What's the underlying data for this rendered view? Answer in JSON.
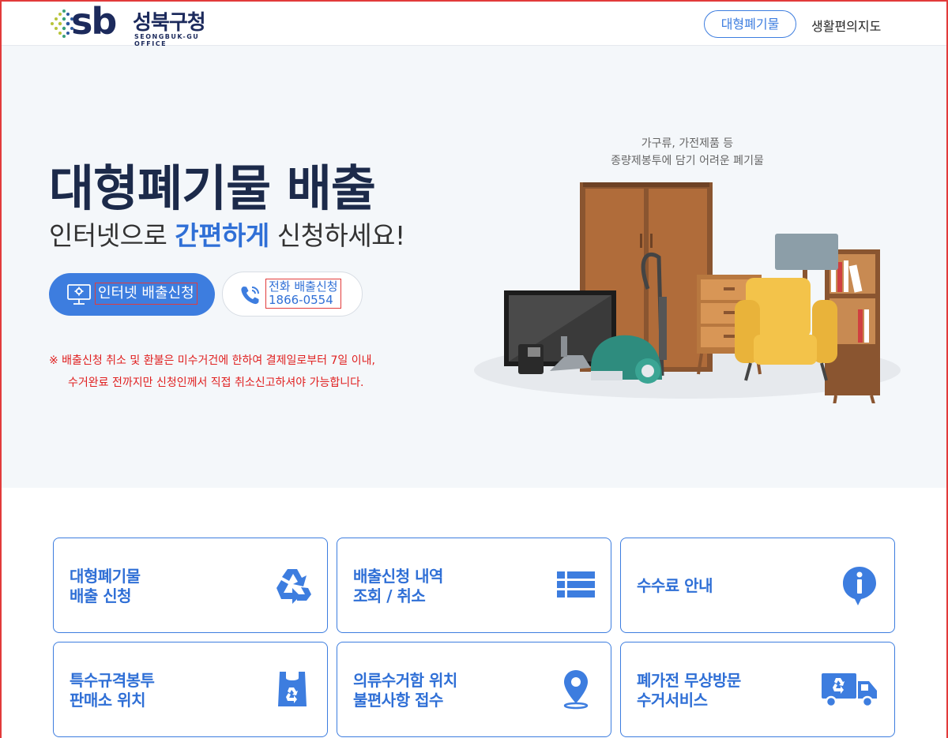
{
  "header": {
    "logo_sb": "sb",
    "logo_name": "성북구청",
    "logo_sub": "SEONGBUK-GU OFFICE",
    "nav_primary": "대형폐기물",
    "nav_secondary": "생활편의지도"
  },
  "hero": {
    "title": "대형폐기물 배출",
    "subtitle_before": "인터넷으로 ",
    "subtitle_highlight": "간편하게",
    "subtitle_after": " 신청하세요!",
    "internet_button": "인터넷 배출신청",
    "phone_button_line1": "전화 배출신청",
    "phone_button_line2": "1866-0554",
    "notice_line1": "※ 배출신청 취소 및 환불은 미수거건에 한하여 결제일로부터 7일 이내,",
    "notice_line2": "수거완료 전까지만 신청인께서 직접 취소신고하셔야 가능합니다.",
    "illustration_caption_line1": "가구류, 가전제품 등",
    "illustration_caption_line2": "종량제봉투에 담기 어려운 폐기물"
  },
  "cards": [
    {
      "title": "대형폐기물\n배출 신청",
      "icon": "recycle-icon"
    },
    {
      "title": "배출신청 내역\n조회 / 취소",
      "icon": "list-icon"
    },
    {
      "title": "수수료 안내",
      "icon": "info-icon"
    },
    {
      "title": "특수규격봉투\n판매소 위치",
      "icon": "recycle-bag-icon"
    },
    {
      "title": "의류수거함 위치\n불편사항 접수",
      "icon": "map-pin-icon"
    },
    {
      "title": "폐가전 무상방문\n수거서비스",
      "icon": "recycle-truck-icon"
    }
  ],
  "colors": {
    "primary": "#3d7ddf",
    "navy": "#1c2a4a",
    "notice_red": "#e02020",
    "hero_bg": "#f4f7fa"
  }
}
